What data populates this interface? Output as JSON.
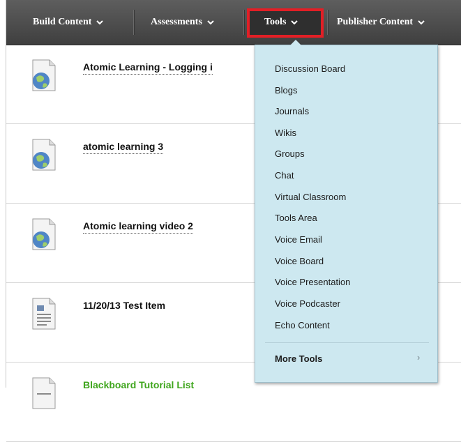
{
  "toolbar": {
    "build_content": "Build Content",
    "assessments": "Assessments",
    "tools": "Tools",
    "publisher_content": "Publisher Content"
  },
  "items": [
    {
      "title": "Atomic Learning - Logging i",
      "icon": "globe-document-icon",
      "style": "dotted"
    },
    {
      "title": "atomic learning 3",
      "icon": "globe-document-icon",
      "style": "dotted"
    },
    {
      "title": "Atomic learning video 2",
      "icon": "globe-document-icon",
      "style": "dotted"
    },
    {
      "title": "11/20/13 Test Item",
      "icon": "text-document-icon",
      "style": "plain"
    },
    {
      "title": "Blackboard Tutorial List",
      "icon": "text-document-icon",
      "style": "green"
    }
  ],
  "menu": {
    "items": [
      "Discussion Board",
      "Blogs",
      "Journals",
      "Wikis",
      "Groups",
      "Chat",
      "Virtual Classroom",
      "Tools Area",
      "Voice Email",
      "Voice Board",
      "Voice Presentation",
      "Voice Podcaster",
      "Echo Content"
    ],
    "more_tools": "More Tools"
  },
  "colors": {
    "toolbar": "#4a4a4a",
    "highlight": "#e21f26",
    "menu_bg": "#cde8f0",
    "green_link": "#3ea51c"
  }
}
